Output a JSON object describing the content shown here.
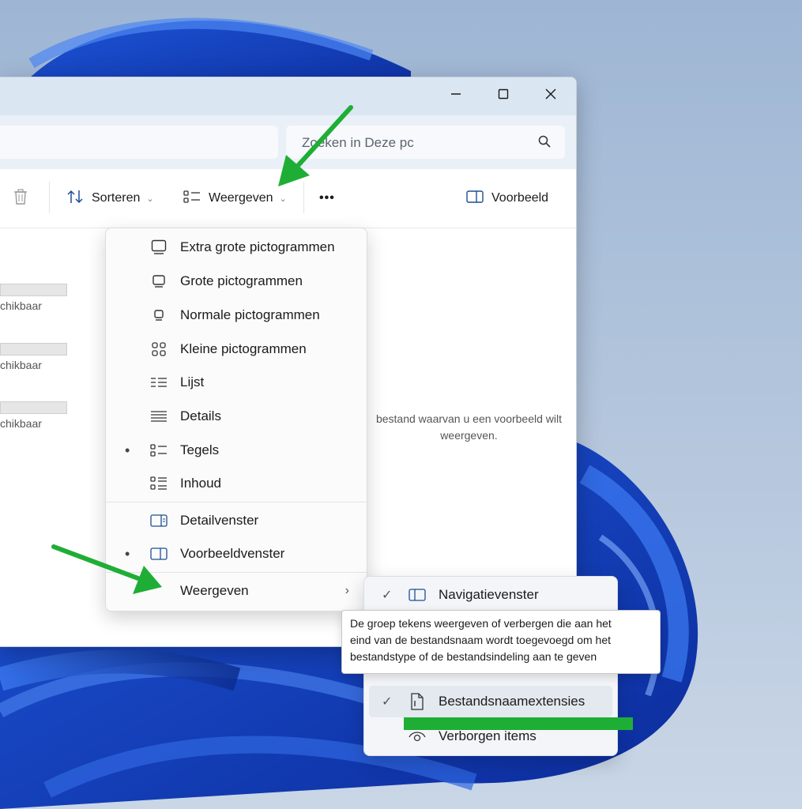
{
  "window": {
    "search_placeholder": "Zoeken in Deze pc",
    "controls": {
      "minimize": "minimize-icon",
      "maximize": "maximize-icon",
      "close": "close-icon"
    }
  },
  "toolbar": {
    "sort_label": "Sorteren",
    "view_label": "Weergeven",
    "more_label": "•••",
    "preview_label": "Voorbeeld"
  },
  "content": {
    "drive_status": [
      "chikbaar",
      "chikbaar",
      "chikbaar"
    ],
    "preview_message_line1": "bestand waarvan u een voorbeeld wilt",
    "preview_message_line2": "weergeven."
  },
  "view_menu": {
    "items": [
      {
        "label": "Extra grote pictogrammen",
        "icon": "monitor-large-icon",
        "selected": false
      },
      {
        "label": "Grote pictogrammen",
        "icon": "monitor-icon",
        "selected": false
      },
      {
        "label": "Normale pictogrammen",
        "icon": "monitor-small-icon",
        "selected": false
      },
      {
        "label": "Kleine pictogrammen",
        "icon": "small-icons-grid-icon",
        "selected": false
      },
      {
        "label": "Lijst",
        "icon": "list-icon",
        "selected": false
      },
      {
        "label": "Details",
        "icon": "details-icon",
        "selected": false
      },
      {
        "label": "Tegels",
        "icon": "tiles-icon",
        "selected": true
      },
      {
        "label": "Inhoud",
        "icon": "content-icon",
        "selected": false
      }
    ],
    "panes": [
      {
        "label": "Detailvenster",
        "icon": "details-pane-icon",
        "selected": false
      },
      {
        "label": "Voorbeeldvenster",
        "icon": "preview-pane-icon",
        "selected": true
      }
    ],
    "show_label": "Weergeven",
    "bullet": "•"
  },
  "show_submenu": {
    "items": [
      {
        "label": "Navigatievenster",
        "icon": "navigation-pane-icon",
        "checked": true
      },
      {
        "label": "Bestandsnaamextensies",
        "icon": "file-extension-icon",
        "checked": true
      },
      {
        "label": "Verborgen items",
        "icon": "eye-icon",
        "checked": false
      }
    ],
    "check": "✓"
  },
  "tooltip": {
    "line1": "De groep tekens weergeven of verbergen die aan het",
    "line2": "eind van de bestandsnaam wordt toegevoegd om het",
    "line3": "bestandstype of de bestandsindeling aan te geven"
  },
  "colors": {
    "accent": "#0067c0",
    "annotation_green": "#1fae35"
  }
}
